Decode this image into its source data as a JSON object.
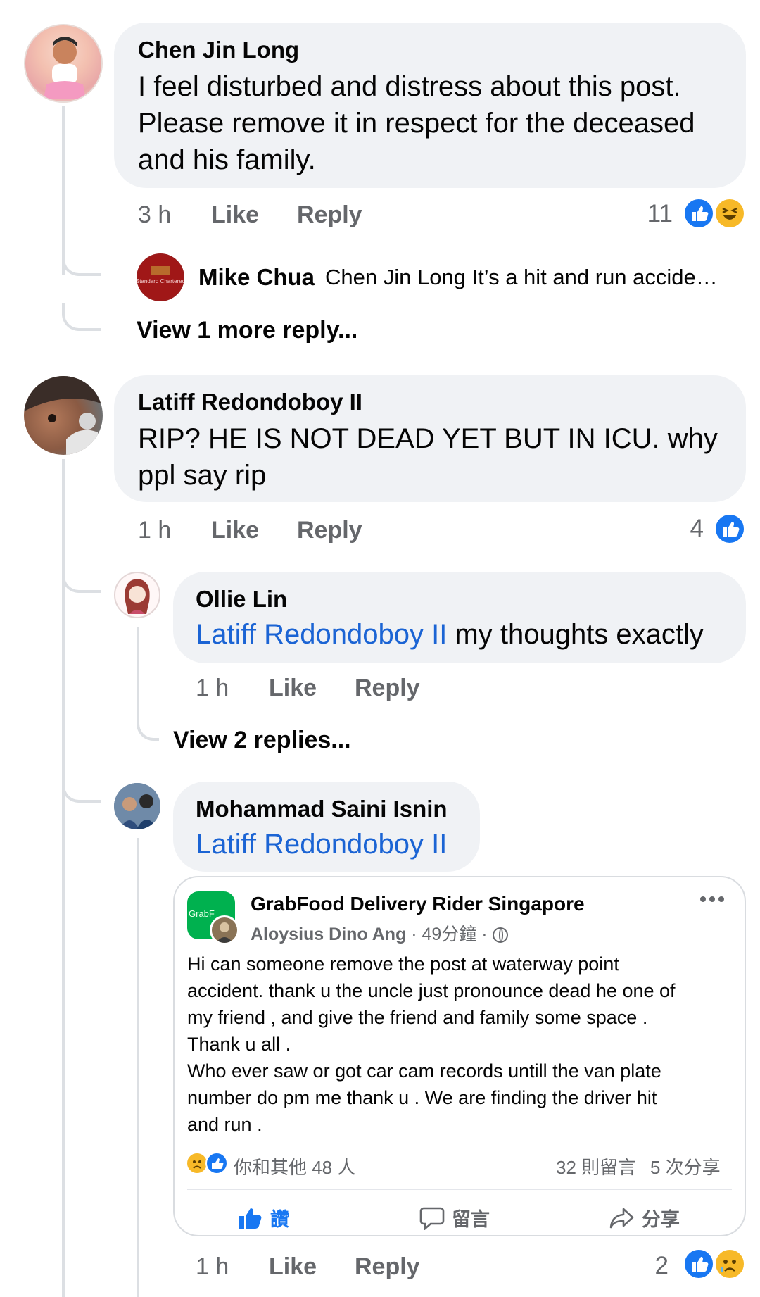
{
  "comments": [
    {
      "author": "Chen Jin Long",
      "lines": [
        "I feel disturbed and distress about this post.",
        "Please remove it in respect for the deceased",
        "and his family."
      ],
      "time": "3 h",
      "like_label": "Like",
      "reply_label": "Reply",
      "reaction_count": "11",
      "reactions": [
        "like",
        "haha"
      ],
      "reply_preview": {
        "author": "Mike Chua",
        "text": "Chen Jin Long It’s a hit and run accide…",
        "avatar_logo": "Standard Chartered"
      },
      "view_more": "View 1 more reply..."
    },
    {
      "author": "Latiff Redondoboy II",
      "lines": [
        "RIP? HE IS NOT DEAD YET BUT IN ICU. why",
        "ppl say rip"
      ],
      "time": "1 h",
      "like_label": "Like",
      "reply_label": "Reply",
      "reaction_count": "4",
      "reactions": [
        "like"
      ],
      "replies": [
        {
          "author": "Ollie Lin",
          "mention": "Latiff Redondoboy II",
          "text": " my thoughts exactly",
          "time": "1 h",
          "like_label": "Like",
          "reply_label": "Reply",
          "view_more": "View 2 replies..."
        },
        {
          "author": "Mohammad Saini Isnin",
          "mention": "Latiff Redondoboy II",
          "time": "1 h",
          "like_label": "Like",
          "reply_label": "Reply",
          "reaction_count": "2",
          "reactions": [
            "like",
            "sad"
          ],
          "shared_post": {
            "group": "GrabFood Delivery Rider Singapore",
            "poster": "Aloysius Dino Ang",
            "time": "49分鐘",
            "avatar_text": "GrabF",
            "body": [
              "Hi can someone remove the post at waterway point",
              "accident. thank u the uncle just pronounce dead he one of",
              "my friend , and give the friend and family some space .",
              "Thank u all .",
              "Who ever saw or got car cam records untill the van plate",
              "number do pm me thank u . We are finding the driver hit",
              "and run ."
            ],
            "reactors": "你和其他 48 人",
            "comments_count": "32 則留言",
            "shares_count": "5 次分享",
            "actions": {
              "like": "讚",
              "comment": "留言",
              "share": "分享"
            }
          }
        }
      ]
    }
  ],
  "colors": {
    "bubble": "#f0f2f5",
    "link": "#1b64d4",
    "like_blue": "#1877f2",
    "meta_gray": "#65676b",
    "emoji_yellow": "#f7b928"
  }
}
